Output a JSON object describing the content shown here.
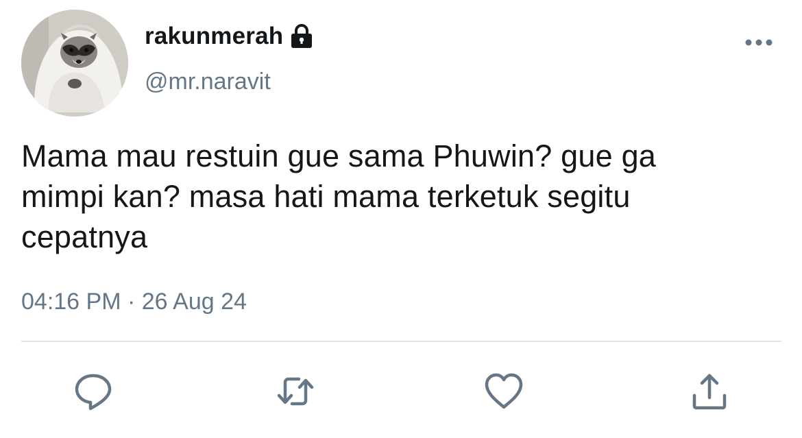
{
  "user": {
    "display_name": "rakunmerah",
    "handle": "@mr.naravit",
    "protected": true,
    "avatar_icon": "raccoon-in-blanket-avatar"
  },
  "tweet": {
    "text": "Mama mau restuin gue sama Phuwin? gue ga\nmimpi kan? masa hati mama terketuk segitu\ncepatnya",
    "time": "04:16 PM",
    "separator": "·",
    "date": "26 Aug 24"
  },
  "actions": {
    "reply_icon": "speech-bubble-icon",
    "retweet_icon": "retweet-arrows-icon",
    "like_icon": "heart-icon",
    "share_icon": "share-upload-icon",
    "more_icon": "ellipsis-icon"
  },
  "colors": {
    "primary_text": "#14171a",
    "secondary_text": "#657786",
    "icon": "#657786",
    "divider": "#e1e8ed"
  }
}
